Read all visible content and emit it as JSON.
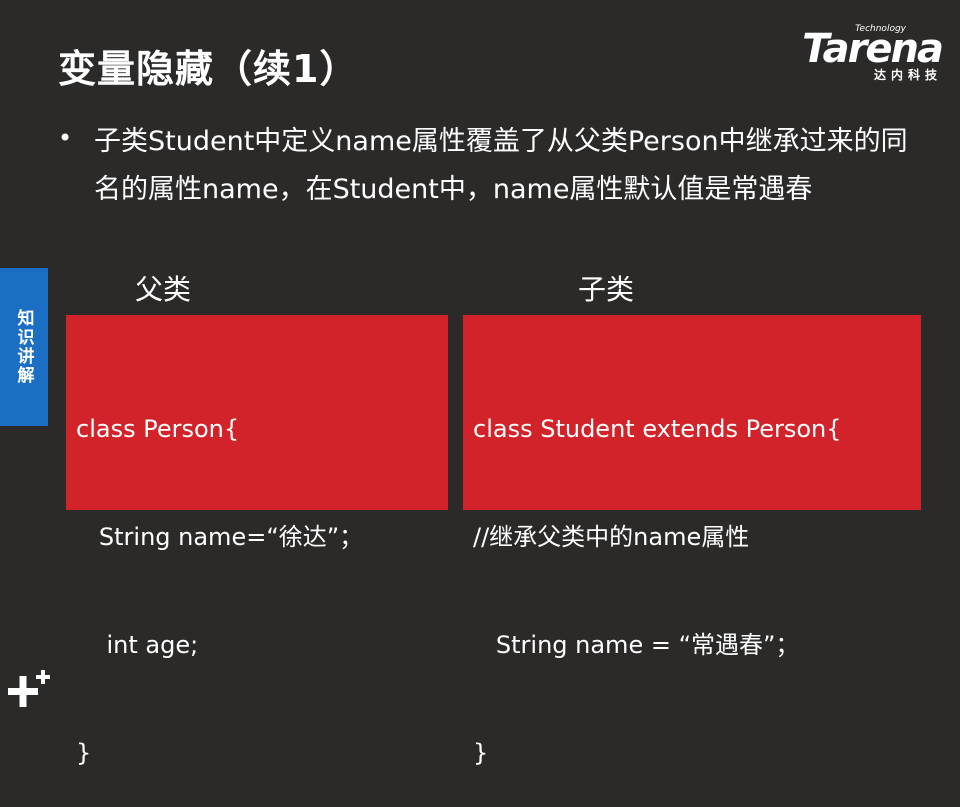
{
  "title": "变量隐藏（续1）",
  "logo": {
    "tagline": "Technology",
    "brand": "Tarena",
    "subtitle": "达内科技"
  },
  "bullet": {
    "text": "子类Student中定义name属性覆盖了从父类Person中继承过来的同名的属性name，在Student中，name属性默认值是常遇春"
  },
  "side_badge": {
    "label": "知识讲解",
    "color": "#1a6fc4"
  },
  "columns": {
    "left_label": "父类",
    "right_label": "子类"
  },
  "code": {
    "left": {
      "lines": [
        "class Person{",
        "   String name=“徐达”；",
        "    int age;",
        "}"
      ]
    },
    "right": {
      "lines": [
        "class Student extends Person{",
        "//继承父类中的name属性",
        "   String name = “常遇春”；",
        "}"
      ]
    },
    "box_color": "#d2232a"
  },
  "colors": {
    "background": "#2b2a29",
    "text": "#ffffff"
  },
  "icons": {
    "corner_mark": "plus-mark-icon"
  }
}
